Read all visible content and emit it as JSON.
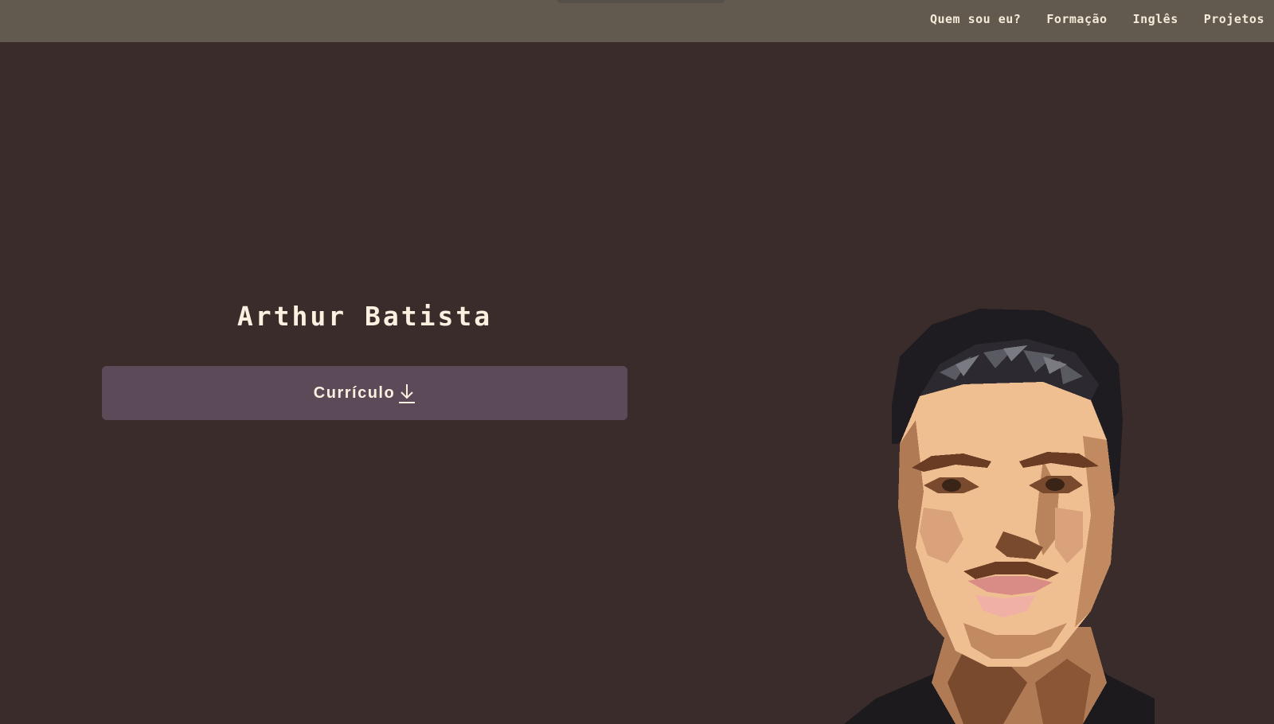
{
  "nav": {
    "links": [
      "Quem sou eu?",
      "Formação",
      "Inglês",
      "Projetos"
    ]
  },
  "hero": {
    "name": "Arthur Batista",
    "cv_button_label": "Currículo",
    "cv_icon": "download-arrow-icon"
  },
  "portrait": {
    "icon": "pixel-art-portrait"
  },
  "colors": {
    "background": "#3a2c2a",
    "navbar": "#625a4e",
    "button": "#5c4a58",
    "text": "#fbf1e0"
  }
}
